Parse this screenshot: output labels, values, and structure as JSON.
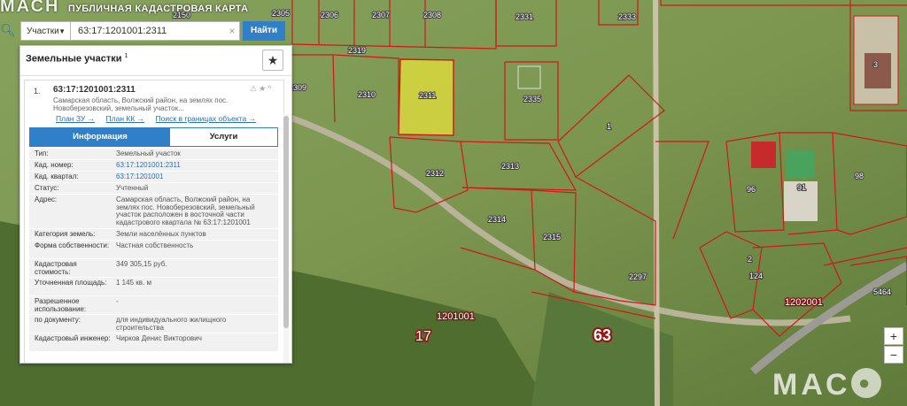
{
  "app": {
    "brand": "МАСН",
    "title": "ПУБЛИЧНАЯ КАДАСТРОВАЯ КАРТА"
  },
  "search": {
    "type_label": "Участки",
    "query": "63:17:1201001:2311",
    "button_label": "Найти"
  },
  "panel": {
    "title": "Земельные участки",
    "title_count": "1",
    "result": {
      "index": "1.",
      "cad_number": "63:17:1201001:2311",
      "address_short": "Самарская область, Волжский район, на землях пос. Новоберезовский, земельный участок...",
      "links": [
        "План ЗУ →",
        "План КК →",
        "Поиск в границах объекта →"
      ],
      "tabs": [
        "Информация",
        "Услуги"
      ],
      "rows": [
        {
          "label": "Тип:",
          "value": "Земельный участок"
        },
        {
          "label": "Кад. номер:",
          "value": "63:17:1201001:2311"
        },
        {
          "label": "Кад. квартал:",
          "value": "63:17:1201001"
        },
        {
          "label": "Статус:",
          "value": "Учтенный"
        },
        {
          "label": "Адрес:",
          "value": "Самарская область, Волжский район, на землях пос. Новоберезовский, земельный участок расположен в восточной части кадастрового квартала № 63:17:1201001"
        },
        {
          "label": "Категория земель:",
          "value": "Земли населённых пунктов"
        },
        {
          "label": "Форма собственности:",
          "value": "Частная собственность"
        },
        {
          "label": "Кадастровая стоимость:",
          "value": "349 305,15 руб."
        },
        {
          "label": "Уточненная площадь:",
          "value": "1 145 кв. м"
        },
        {
          "label": "Разрешенное использование:",
          "value": "-"
        },
        {
          "label": "по документу:",
          "value": "для индивидуального жилищного строительства"
        },
        {
          "label": "Кадастровый инженер:",
          "value": "Чирков Денис Викторович"
        }
      ]
    }
  },
  "map": {
    "parcels": [
      "2150",
      "2305",
      "2306",
      "2307",
      "2308",
      "2331",
      "2333",
      "2319",
      "2309",
      "2310",
      "2311",
      "2335",
      "1",
      "3",
      "2312",
      "2313",
      "2314",
      "2315",
      "2297",
      "96",
      "91",
      "98",
      "2",
      "124",
      "5464"
    ],
    "quarters": [
      "1201001",
      "1202001"
    ],
    "district": "17",
    "region": "63",
    "selected_color": "#e4e03a",
    "boundary_color": "#d01818"
  },
  "controls": {
    "zoom_in": "+",
    "zoom_out": "−",
    "logo": "МАС"
  }
}
